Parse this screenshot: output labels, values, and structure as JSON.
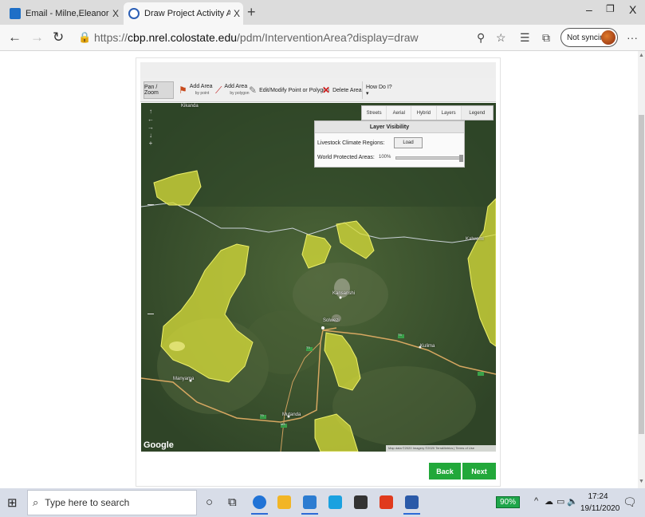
{
  "browser": {
    "tabs": [
      {
        "title": "Email - Milne,Eleanor - Outlook",
        "close": "X",
        "active": false,
        "icon": "outlook-icon"
      },
      {
        "title": "Draw Project Activity Areas - Ca",
        "close": "X",
        "active": true,
        "icon": "edge-icon"
      }
    ],
    "new_tab": "+",
    "window_controls": {
      "minimize": "–",
      "restore": "❐",
      "close": "X"
    },
    "nav": {
      "back": "←",
      "forward": "→",
      "refresh": "↻"
    },
    "url": {
      "scheme": "https://",
      "host": "cbp.nrel.colostate.edu",
      "path": "/pdm/InterventionArea?display=draw"
    },
    "toolbar_icons": [
      "zoom-icon",
      "favorite-star-icon",
      "favorites-list-icon",
      "collections-icon"
    ],
    "profile": {
      "label": "Not syncing"
    },
    "menu": "···"
  },
  "map_toolbar": {
    "pan_zoom": "Pan / Zoom",
    "add_area_point": {
      "label": "Add Area",
      "sub": "by point"
    },
    "add_area_polygon": {
      "label": "Add Area",
      "sub": "by polygon"
    },
    "edit_modify": "Edit/Modify Point or Polygon",
    "delete_area": "Delete Area",
    "how_do_i": "How Do I? ▾"
  },
  "map": {
    "type_tabs": [
      "Streets",
      "Aerial",
      "Hybrid",
      "Layers"
    ],
    "legend": "Legend",
    "layer_visibility": {
      "title": "Layer Visibility",
      "livestock_label": "Livestock Climate Regions:",
      "load_button": "Load",
      "protected_label": "World Protected Areas:",
      "protected_opacity": "100%",
      "protected_opacity_value": 100
    },
    "place_labels": {
      "kikanda": "Kikanda",
      "kansanshi": "Kansanshi",
      "solwezi": "Solwezi",
      "kulima": "Kulima",
      "kalwemi": "Kalwemi",
      "manyama": "Manyama",
      "mutanda": "Mutanda"
    },
    "road_shields": {
      "t5a": "T5",
      "t5b": "T5",
      "t5c": "T5",
      "m8": "M8"
    },
    "google": "Google",
    "attribution": "Map data ©2020 Imagery ©2020 TerraMetrics | Terms of Use",
    "area_fill": "#d9df3a"
  },
  "actions": {
    "back": "Back",
    "next": "Next",
    "accent": "#22a83a"
  },
  "taskbar": {
    "search_placeholder": "Type here to search",
    "battery": "90%",
    "time": "17:24",
    "date": "19/11/2020"
  }
}
